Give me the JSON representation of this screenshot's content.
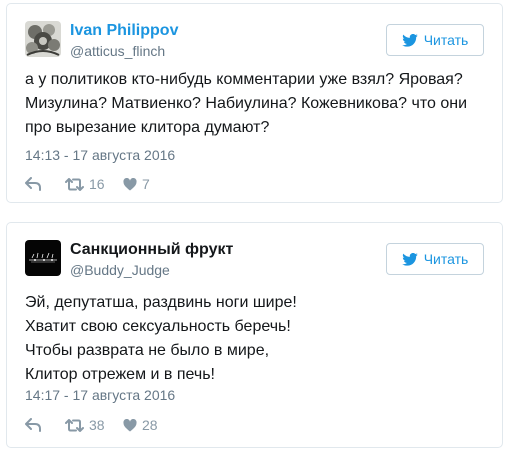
{
  "tweets": [
    {
      "name": "Ivan Philippov",
      "handle": "@atticus_flinch",
      "button_label": "Читать",
      "text_lines": [
        "а у политиков кто-нибудь комментарии уже взял? Яровая?",
        "Мизулина? Матвиенко? Набиулина? Кожевникова? что они",
        "про вырезание клитора думают?"
      ],
      "timestamp": "14:13 - 17 августа 2016",
      "retweets": "16",
      "likes": "7"
    },
    {
      "name": "Санкционный фрукт",
      "handle": "@Buddy_Judge",
      "button_label": "Читать",
      "text_lines": [
        "Эй, депутатша, раздвинь ноги шире!",
        "Хватит свою сексуальность беречь!",
        "Чтобы разврата не было в мире,",
        "Клитор отрежем и в печь!"
      ],
      "timestamp": "14:17 - 17 августа 2016",
      "retweets": "38",
      "likes": "28"
    }
  ],
  "colors": {
    "link_blue": "#1b95e0",
    "text": "#14171a",
    "muted": "#657786",
    "icon": "#8899a6",
    "border": "#e1e8ed"
  },
  "icons": {
    "reply": "reply-icon",
    "retweet": "retweet-icon",
    "like": "heart-icon",
    "brand": "twitter-bird-icon"
  }
}
